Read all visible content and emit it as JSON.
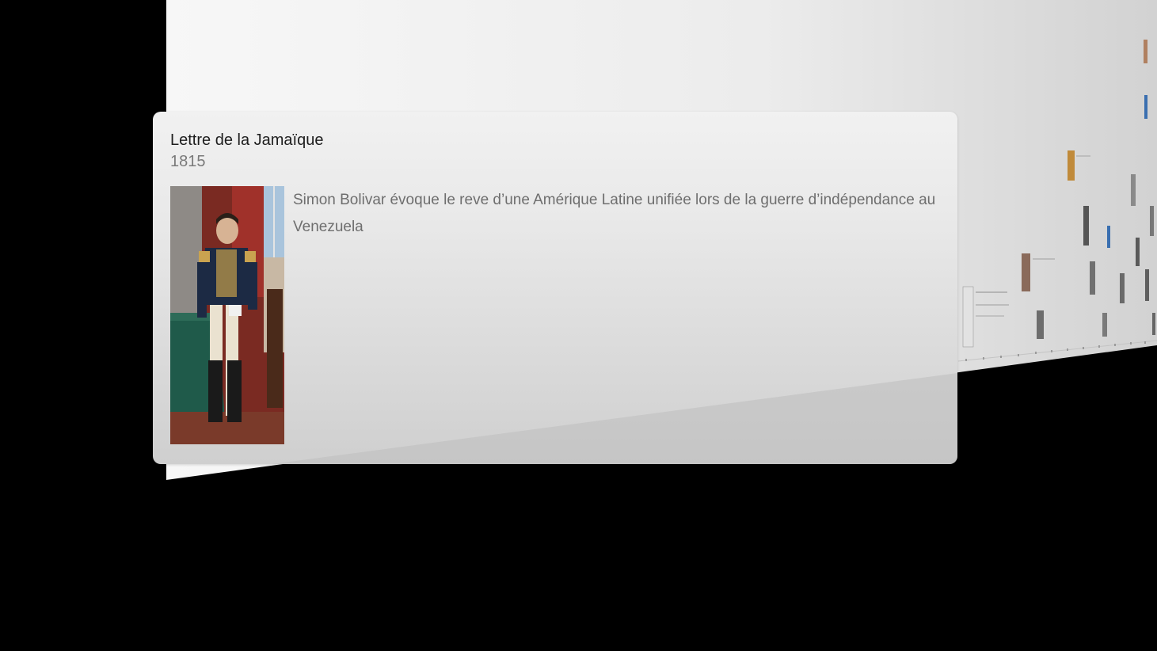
{
  "event": {
    "title": "Lettre de la Jamaïque",
    "year": "1815",
    "description": "Simon Bolivar évoque le reve d’une Amérique Latine unifiée lors de la guerre d’indépendance au Venezuela",
    "image": "portrait-painting"
  },
  "colors": {
    "background": "#000000",
    "card": "#e9e9e9",
    "title_text": "#1e1e1e",
    "secondary_text": "#7a7a7a"
  }
}
